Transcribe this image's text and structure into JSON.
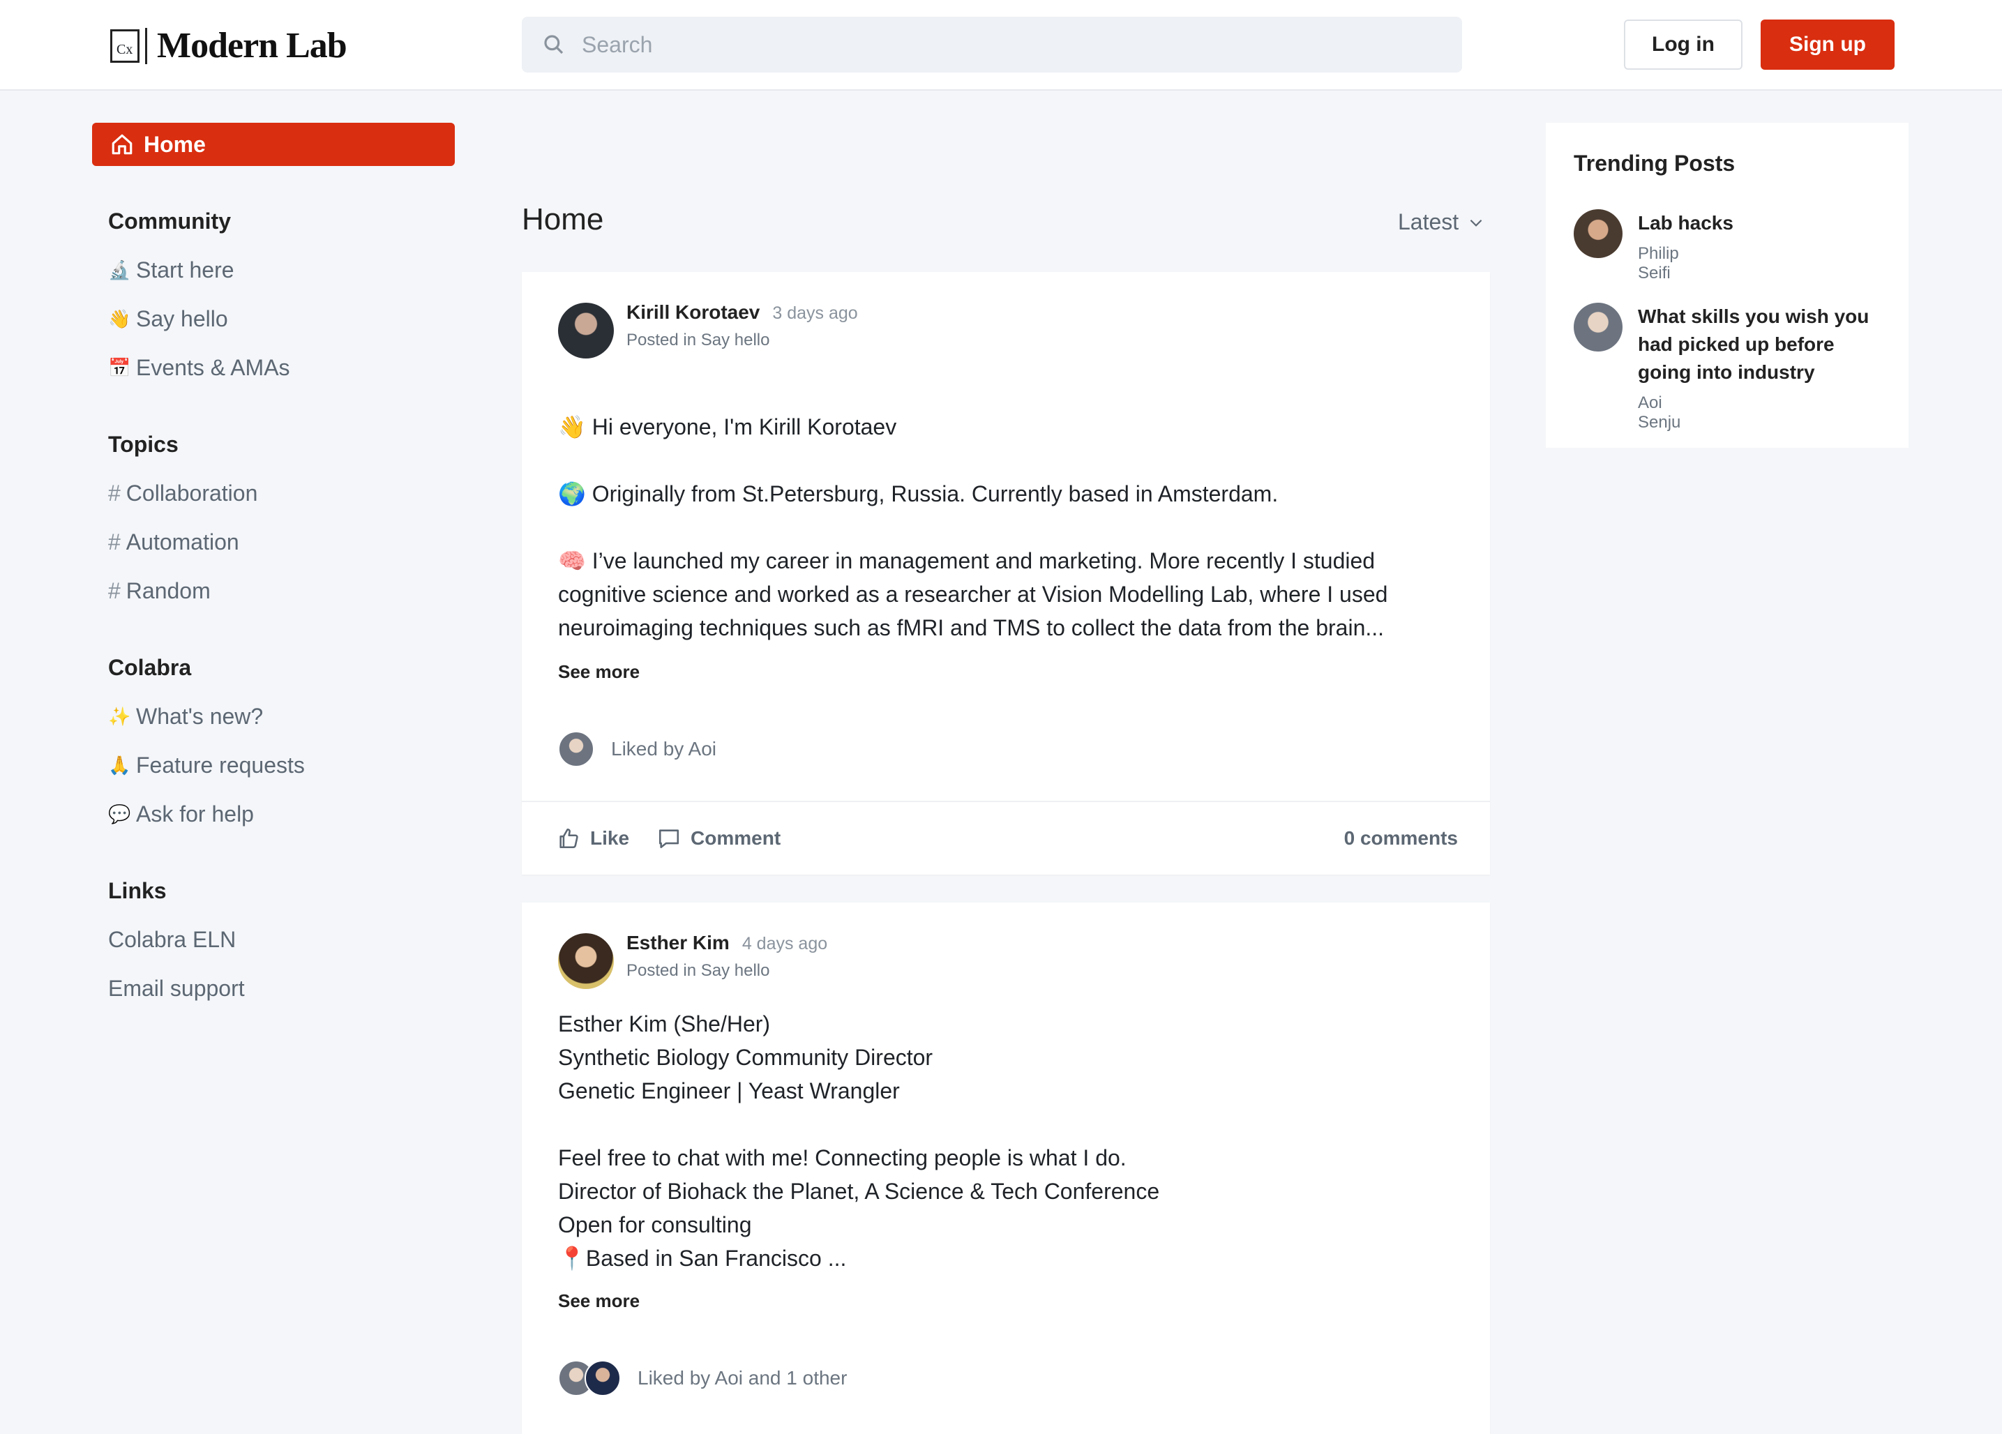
{
  "header": {
    "logo_mark": "Cx",
    "logo_text": "Modern Lab",
    "search_placeholder": "Search",
    "login_label": "Log in",
    "signup_label": "Sign up"
  },
  "sidebar": {
    "home_label": "Home",
    "sections": [
      {
        "heading": "Community",
        "items": [
          {
            "icon": "🔬",
            "label": "Start here"
          },
          {
            "icon": "👋",
            "label": "Say hello"
          },
          {
            "icon": "📅",
            "label": "Events & AMAs"
          }
        ]
      },
      {
        "heading": "Topics",
        "items": [
          {
            "icon": "#",
            "label": "Collaboration"
          },
          {
            "icon": "#",
            "label": "Automation"
          },
          {
            "icon": "#",
            "label": "Random"
          }
        ]
      },
      {
        "heading": "Colabra",
        "items": [
          {
            "icon": "✨",
            "label": "What's new?"
          },
          {
            "icon": "🙏",
            "label": "Feature requests"
          },
          {
            "icon": "💬",
            "label": "Ask for help"
          }
        ]
      },
      {
        "heading": "Links",
        "items": [
          {
            "icon": "",
            "label": "Colabra ELN"
          },
          {
            "icon": "",
            "label": "Email support"
          }
        ]
      }
    ]
  },
  "feed": {
    "title": "Home",
    "sort_label": "Latest",
    "posts": [
      {
        "author": "Kirill Korotaev",
        "time": "3 days ago",
        "posted_in": "Posted in Say hello",
        "lines": [
          "👋 Hi everyone, I'm Kirill Korotaev",
          "",
          "🌍 Originally from St.Petersburg, Russia. Currently based in Amsterdam.",
          "",
          "🧠 I’ve launched my career in management and marketing. More recently I studied cognitive science and worked as a researcher at Vision Modelling Lab, where I used neuroimaging techniques such as fMRI and TMS to collect the data from the brain..."
        ],
        "see_more": "See more",
        "liked_by": "Liked by Aoi",
        "like_label": "Like",
        "comment_label": "Comment",
        "comments_count": "0 comments"
      },
      {
        "author": "Esther Kim",
        "time": "4 days ago",
        "posted_in": "Posted in Say hello",
        "lines": [
          "Esther Kim (She/Her)",
          "Synthetic Biology Community Director",
          "Genetic Engineer | Yeast Wrangler",
          "",
          "Feel free to chat with me! Connecting people is what I do.",
          "Director of Biohack the Planet, A Science & Tech Conference",
          "Open for consulting",
          "📍Based in San Francisco ..."
        ],
        "see_more": "See more",
        "liked_by": "Liked by Aoi and 1 other"
      }
    ]
  },
  "trending": {
    "title": "Trending Posts",
    "items": [
      {
        "title": "Lab hacks",
        "author": "Philip Seifi"
      },
      {
        "title": "What skills you wish you had picked up before going into industry",
        "author": "Aoi Senju"
      }
    ]
  },
  "colors": {
    "accent": "#d92e10",
    "background": "#f4f6f9"
  }
}
